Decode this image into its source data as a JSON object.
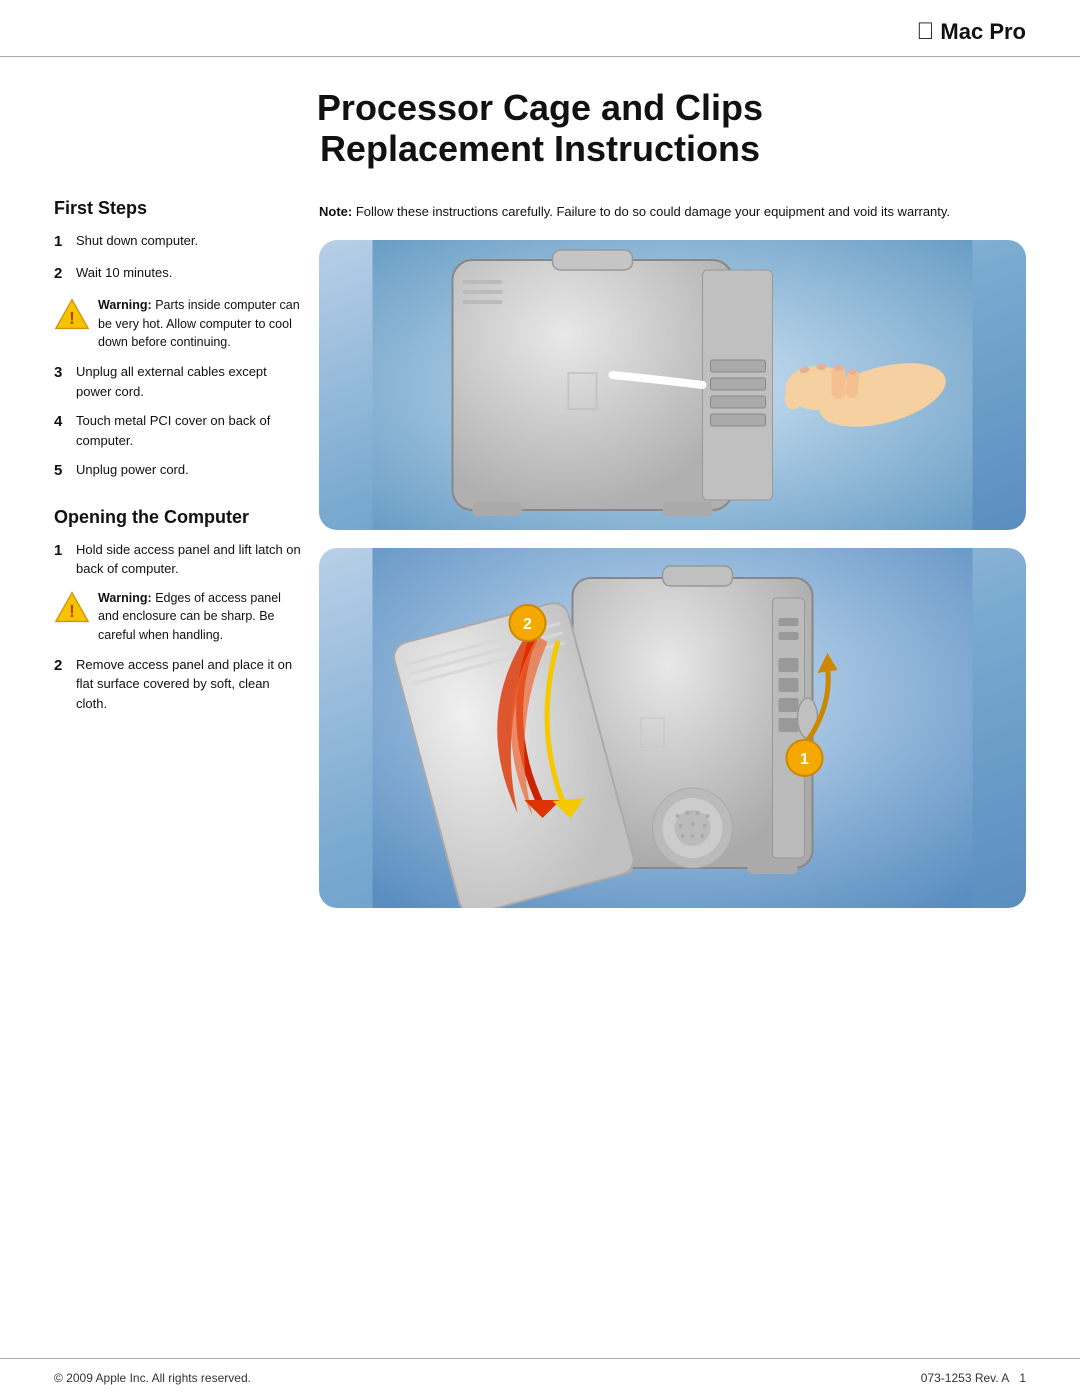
{
  "header": {
    "apple_logo": "&#63743;",
    "title": "Mac Pro"
  },
  "doc_title": {
    "line1": "Processor Cage and Clips",
    "line2": "Replacement Instructions"
  },
  "first_steps": {
    "heading": "First Steps",
    "note_label": "Note:",
    "note_text": "Follow these instructions carefully. Failure to do so could damage your equipment and void its warranty.",
    "steps": [
      {
        "num": "1",
        "text": "Shut down computer."
      },
      {
        "num": "2",
        "text": "Wait 10 minutes."
      },
      {
        "num": "3",
        "text": "Unplug all external cables except power cord."
      },
      {
        "num": "4",
        "text": "Touch metal PCI cover on back of computer."
      },
      {
        "num": "5",
        "text": "Unplug power cord."
      }
    ],
    "warning": {
      "label": "Warning:",
      "text": "Parts inside computer can be very hot. Allow computer to cool down before continuing."
    }
  },
  "opening_computer": {
    "heading": "Opening the Computer",
    "steps": [
      {
        "num": "1",
        "text": "Hold side access panel and lift latch on back of computer."
      },
      {
        "num": "2",
        "text": "Remove access panel and place it on flat surface covered by soft, clean cloth."
      }
    ],
    "warning": {
      "label": "Warning:",
      "text": "Edges of access panel and enclosure can be sharp. Be careful when handling."
    }
  },
  "footer": {
    "copyright": "© 2009 Apple Inc. All rights reserved.",
    "revision": "073-1253 Rev. A",
    "page": "1"
  }
}
